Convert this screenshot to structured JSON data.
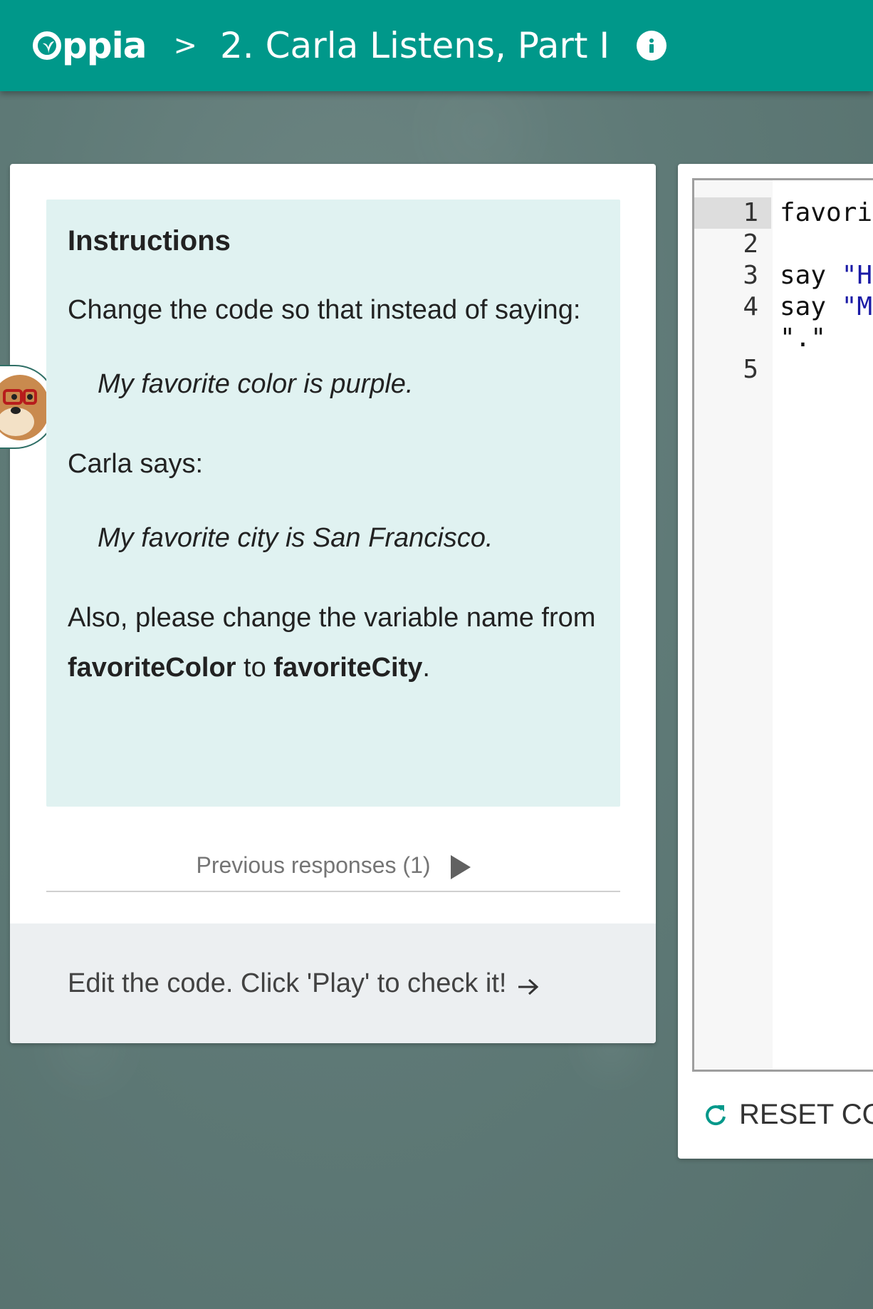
{
  "header": {
    "logo_text": "ppia",
    "breadcrumb_separator": ">",
    "title": "2. Carla Listens, Part I",
    "info_icon": "info-icon",
    "background": "#00988a"
  },
  "instructions": {
    "heading": "Instructions",
    "intro": "Change the code so that instead of saying:",
    "quote1": "My favorite color is purple.",
    "carla_says": "Carla says:",
    "quote2": "My favorite city is San Francisco.",
    "also_text": "Also, please change the variable name from ",
    "old_var": "favoriteColor",
    "to_text": " to ",
    "new_var": "favoriteCity",
    "period": ".",
    "background": "#e0f2f1"
  },
  "previous_responses": {
    "label": "Previous responses (1)",
    "icon": "play-triangle-icon"
  },
  "feedback": {
    "text": "Edit the code. Click 'Play' to check it!",
    "icon": "arrow-right-icon"
  },
  "editor": {
    "lines": [
      {
        "num": "1",
        "code": "favori"
      },
      {
        "num": "2",
        "code": ""
      },
      {
        "num": "3",
        "keyword": "say ",
        "string": "\"H"
      },
      {
        "num": "4",
        "keyword": "say ",
        "string": "\"M"
      },
      {
        "num": "",
        "string": "\".\""
      },
      {
        "num": "5",
        "code": ""
      }
    ]
  },
  "reset_button": {
    "label": "RESET CO",
    "icon": "refresh-icon",
    "icon_color": "#00988a"
  }
}
